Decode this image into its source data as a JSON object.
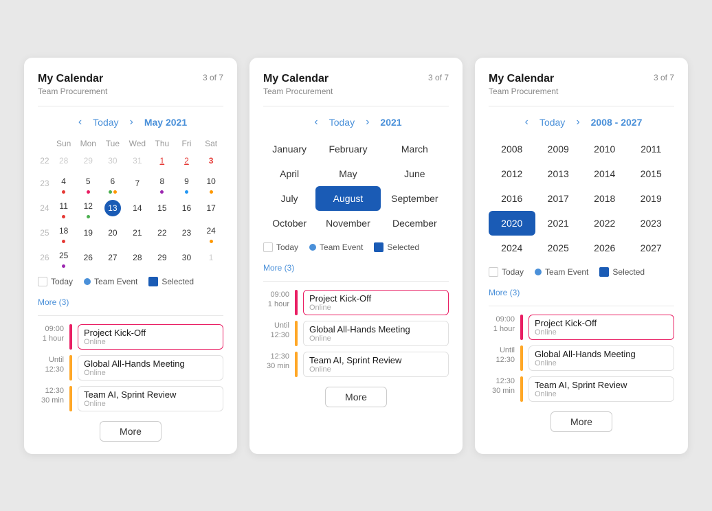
{
  "cards": [
    {
      "id": "card-day",
      "title": "My Calendar",
      "subtitle": "Team Procurement",
      "count": "3 of 7",
      "type": "day",
      "nav": {
        "today_label": "Today",
        "title": "May 2021"
      },
      "weekdays": [
        "Sun",
        "Mon",
        "Tue",
        "Wed",
        "Thu",
        "Fri",
        "Sat"
      ],
      "weeks": [
        {
          "num": 22,
          "days": [
            {
              "label": "28",
              "other": true
            },
            {
              "label": "29",
              "other": true
            },
            {
              "label": "30",
              "other": true
            },
            {
              "label": "31",
              "other": true
            },
            {
              "label": "1",
              "special": "red-underline"
            },
            {
              "label": "2",
              "special": "red-underline"
            },
            {
              "label": "3",
              "special": "red-right"
            }
          ]
        },
        {
          "num": 23,
          "days": [
            {
              "label": "4",
              "dot_colors": [
                "#e53935"
              ]
            },
            {
              "label": "5",
              "dot_colors": [
                "#e91e63"
              ]
            },
            {
              "label": "6",
              "dot_colors": [
                "#4caf50",
                "#ff9800"
              ]
            },
            {
              "label": "7"
            },
            {
              "label": "8",
              "dot_colors": [
                "#9c27b0"
              ]
            },
            {
              "label": "9",
              "dot_colors": [
                "#2196f3"
              ]
            },
            {
              "label": "10",
              "dot_colors": [
                "#ff9800"
              ]
            }
          ]
        },
        {
          "num": 24,
          "days": [
            {
              "label": "11",
              "dot_colors": [
                "#e53935"
              ]
            },
            {
              "label": "12",
              "dot_colors": [
                "#4caf50"
              ]
            },
            {
              "label": "13",
              "selected": true
            },
            {
              "label": "14"
            },
            {
              "label": "15"
            },
            {
              "label": "16"
            },
            {
              "label": "17"
            }
          ]
        },
        {
          "num": 25,
          "days": [
            {
              "label": "18",
              "dot_colors": [
                "#e53935"
              ]
            },
            {
              "label": "19"
            },
            {
              "label": "20"
            },
            {
              "label": "21"
            },
            {
              "label": "22"
            },
            {
              "label": "23"
            },
            {
              "label": "24",
              "dot_colors": [
                "#ff9800"
              ]
            }
          ]
        },
        {
          "num": 26,
          "days": [
            {
              "label": "25",
              "dot_colors": [
                "#9c27b0"
              ]
            },
            {
              "label": "26"
            },
            {
              "label": "27"
            },
            {
              "label": "28"
            },
            {
              "label": "29"
            },
            {
              "label": "30"
            },
            {
              "label": "1",
              "other": true
            }
          ]
        }
      ],
      "legend": {
        "today": "Today",
        "team_event": "Team Event",
        "selected": "Selected",
        "more": "More (3)"
      },
      "events": [
        {
          "time_main": "09:00",
          "time_sub": "1 hour",
          "bar_color": "#e91e63",
          "border_color": "#e91e63",
          "title": "Project Kick-Off",
          "sub": "Online"
        },
        {
          "time_main": "Until",
          "time_sub": "12:30",
          "bar_color": "#ffa726",
          "border_color": "#e0e0e0",
          "title": "Global All-Hands Meeting",
          "sub": "Online"
        },
        {
          "time_main": "12:30",
          "time_sub": "30 min",
          "bar_color": "#ffa726",
          "border_color": "#e0e0e0",
          "title": "Team AI, Sprint Review",
          "sub": "Online"
        }
      ],
      "more_label": "More"
    },
    {
      "id": "card-month",
      "title": "My Calendar",
      "subtitle": "Team Procurement",
      "count": "3 of 7",
      "type": "month",
      "nav": {
        "today_label": "Today",
        "title": "2021"
      },
      "months": [
        [
          "January",
          "February",
          "March"
        ],
        [
          "April",
          "May",
          "June"
        ],
        [
          "July",
          "August",
          "September"
        ],
        [
          "October",
          "November",
          "December"
        ]
      ],
      "selected_month": "August",
      "legend": {
        "today": "Today",
        "team_event": "Team Event",
        "selected": "Selected",
        "more": "More (3)"
      },
      "events": [
        {
          "time_main": "09:00",
          "time_sub": "1 hour",
          "bar_color": "#e91e63",
          "border_color": "#e91e63",
          "title": "Project Kick-Off",
          "sub": "Online"
        },
        {
          "time_main": "Until",
          "time_sub": "12:30",
          "bar_color": "#ffa726",
          "border_color": "#e0e0e0",
          "title": "Global All-Hands Meeting",
          "sub": "Online"
        },
        {
          "time_main": "12:30",
          "time_sub": "30 min",
          "bar_color": "#ffa726",
          "border_color": "#e0e0e0",
          "title": "Team AI, Sprint Review",
          "sub": "Online"
        }
      ],
      "more_label": "More"
    },
    {
      "id": "card-year",
      "title": "My Calendar",
      "subtitle": "Team Procurement",
      "count": "3 of 7",
      "type": "year",
      "nav": {
        "today_label": "Today",
        "title": "2008 - 2027"
      },
      "years": [
        [
          2008,
          2009,
          2010,
          2011
        ],
        [
          2012,
          2013,
          2014,
          2015
        ],
        [
          2016,
          2017,
          2018,
          2019
        ],
        [
          2020,
          2021,
          2022,
          2023
        ],
        [
          2024,
          2025,
          2026,
          2027
        ]
      ],
      "selected_year": 2020,
      "legend": {
        "today": "Today",
        "team_event": "Team Event",
        "selected": "Selected",
        "more": "More (3)"
      },
      "events": [
        {
          "time_main": "09:00",
          "time_sub": "1 hour",
          "bar_color": "#e91e63",
          "border_color": "#e91e63",
          "title": "Project Kick-Off",
          "sub": "Online"
        },
        {
          "time_main": "Until",
          "time_sub": "12:30",
          "bar_color": "#ffa726",
          "border_color": "#e0e0e0",
          "title": "Global All-Hands Meeting",
          "sub": "Online"
        },
        {
          "time_main": "12:30",
          "time_sub": "30 min",
          "bar_color": "#ffa726",
          "border_color": "#e0e0e0",
          "title": "Team AI, Sprint Review",
          "sub": "Online"
        }
      ],
      "more_label": "More"
    }
  ]
}
